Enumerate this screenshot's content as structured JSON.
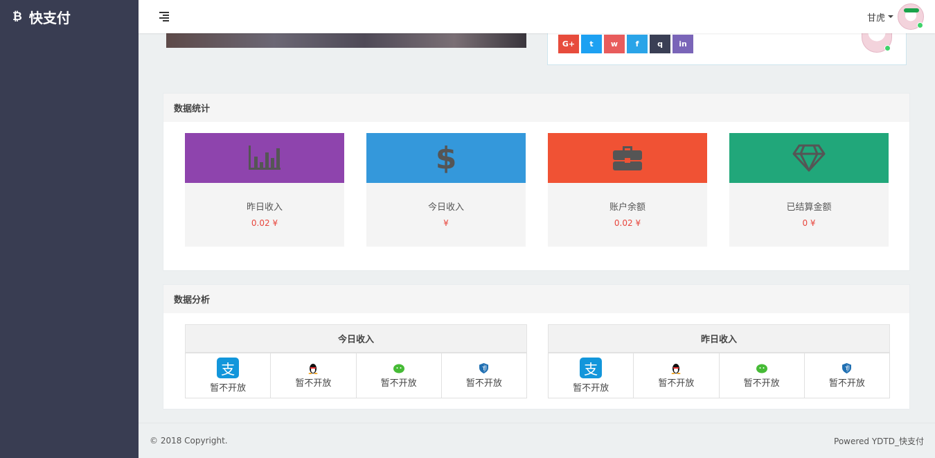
{
  "sidebar": {
    "brand_icon": "bitcoin-icon",
    "brand": "快支付"
  },
  "topbar": {
    "menu_icon": "menu-icon",
    "user_name": "甘虎"
  },
  "profile": {
    "socials": [
      {
        "name": "google-plus-icon",
        "glyph": "G+",
        "color": "#e74c3c"
      },
      {
        "name": "twitter-icon",
        "glyph": "t",
        "color": "#1da1f2"
      },
      {
        "name": "weibo-icon",
        "glyph": "w",
        "color": "#e85c5c"
      },
      {
        "name": "facebook-icon",
        "glyph": "f",
        "color": "#2aa4e8"
      },
      {
        "name": "qq-icon",
        "glyph": "q",
        "color": "#3a3f55"
      },
      {
        "name": "linkedin-icon",
        "glyph": "in",
        "color": "#7a65b8"
      }
    ]
  },
  "stats_panel": {
    "title": "数据统计",
    "cards": [
      {
        "icon": "bar-chart-icon",
        "color": "#8e44ad",
        "label": "昨日收入",
        "value": "0.02 ¥"
      },
      {
        "icon": "dollar-icon",
        "color": "#3498db",
        "label": "今日收入",
        "value": "¥"
      },
      {
        "icon": "briefcase-icon",
        "color": "#f05234",
        "label": "账户余额",
        "value": "0.02 ¥"
      },
      {
        "icon": "diamond-icon",
        "color": "#21a77a",
        "label": "已结算金额",
        "value": "0 ¥"
      }
    ]
  },
  "analysis_panel": {
    "title": "数据分析",
    "today": {
      "title": "今日收入",
      "channels": [
        {
          "icon": "alipay-icon",
          "status": "暂不开放"
        },
        {
          "icon": "qq-penguin-icon",
          "status": "暂不开放"
        },
        {
          "icon": "wechat-icon",
          "status": "暂不开放"
        },
        {
          "icon": "shield-icon",
          "status": "暂不开放"
        }
      ]
    },
    "yesterday": {
      "title": "昨日收入",
      "channels": [
        {
          "icon": "alipay-icon",
          "status": "暂不开放"
        },
        {
          "icon": "qq-penguin-icon",
          "status": "暂不开放"
        },
        {
          "icon": "wechat-icon",
          "status": "暂不开放"
        },
        {
          "icon": "shield-icon",
          "status": "暂不开放"
        }
      ]
    }
  },
  "footer": {
    "copyright": "© 2018 Copyright.",
    "powered": "Powered YDTD_快支付"
  }
}
